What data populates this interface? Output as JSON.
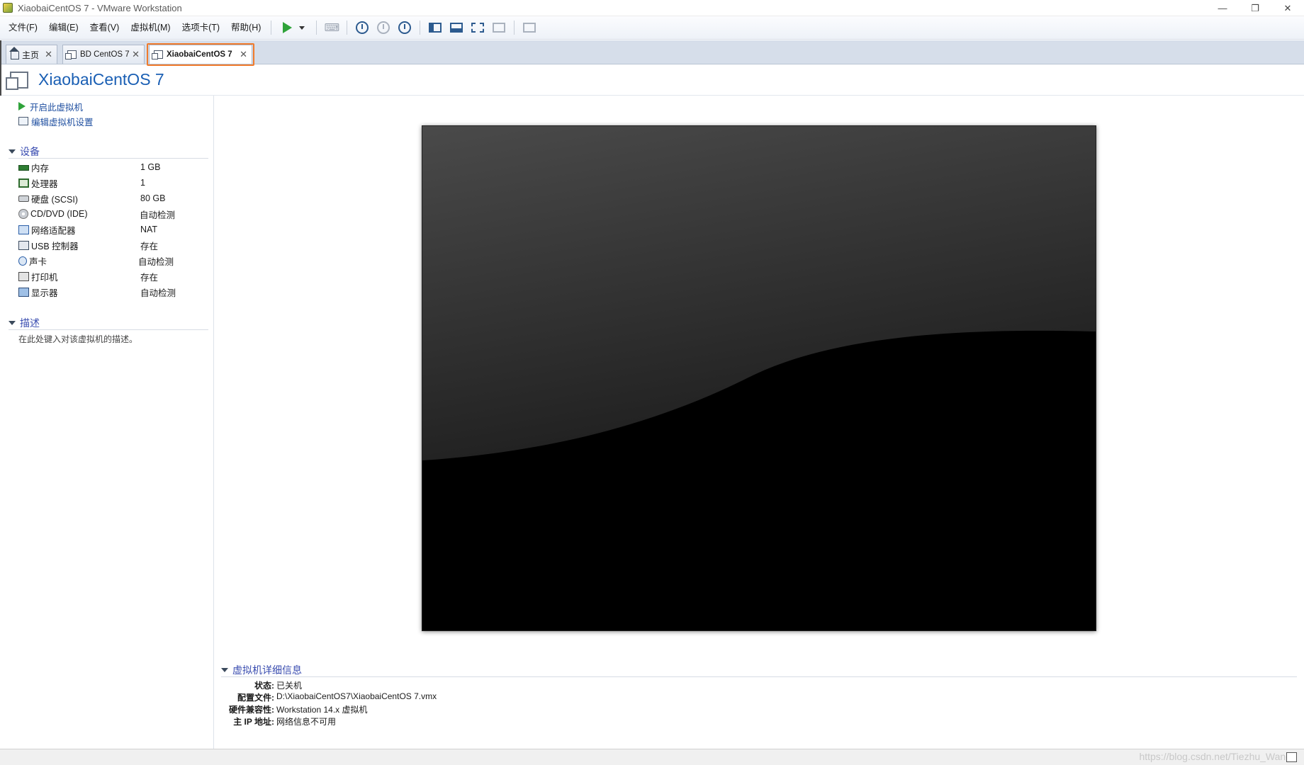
{
  "window": {
    "title": "XiaobaiCentOS 7 - VMware Workstation",
    "controls": [
      "—",
      "❐",
      "✕"
    ]
  },
  "menu": [
    "文件(F)",
    "编辑(E)",
    "查看(V)",
    "虚拟机(M)",
    "选项卡(T)",
    "帮助(H)"
  ],
  "tabs": [
    {
      "label": "主页",
      "icon": "home-icon"
    },
    {
      "label": "BD CentOS 7",
      "icon": "vm-icon"
    },
    {
      "label": "XiaobaiCentOS 7",
      "icon": "vm-icon",
      "active": true
    }
  ],
  "vm": {
    "name": "XiaobaiCentOS 7"
  },
  "actions": {
    "power_on": "开启此虚拟机",
    "edit_settings": "编辑虚拟机设置"
  },
  "devices": {
    "header": "设备",
    "items": [
      {
        "name": "内存",
        "value": "1 GB"
      },
      {
        "name": "处理器",
        "value": "1"
      },
      {
        "name": "硬盘 (SCSI)",
        "value": "80 GB"
      },
      {
        "name": "CD/DVD (IDE)",
        "value": "自动检测"
      },
      {
        "name": "网络适配器",
        "value": "NAT"
      },
      {
        "name": "USB 控制器",
        "value": "存在"
      },
      {
        "name": "声卡",
        "value": "自动检测"
      },
      {
        "name": "打印机",
        "value": "存在"
      },
      {
        "name": "显示器",
        "value": "自动检测"
      }
    ]
  },
  "description": {
    "header": "描述",
    "placeholder": "在此处键入对该虚拟机的描述。"
  },
  "details": {
    "header": "虚拟机详细信息",
    "rows": [
      {
        "key": "状态:",
        "value": "已关机"
      },
      {
        "key": "配置文件:",
        "value": "D:\\XiaobaiCentOS7\\XiaobaiCentOS 7.vmx"
      },
      {
        "key": "硬件兼容性:",
        "value": "Workstation 14.x 虚拟机"
      },
      {
        "key": "主 IP 地址:",
        "value": "网络信息不可用"
      }
    ]
  },
  "status": {
    "watermark": "https://blog.csdn.net/Tiezhu_Wang"
  },
  "colors": {
    "accent": "#1a5fb4",
    "play": "#2fa33a",
    "tab_highlight": "#f07a2a"
  }
}
